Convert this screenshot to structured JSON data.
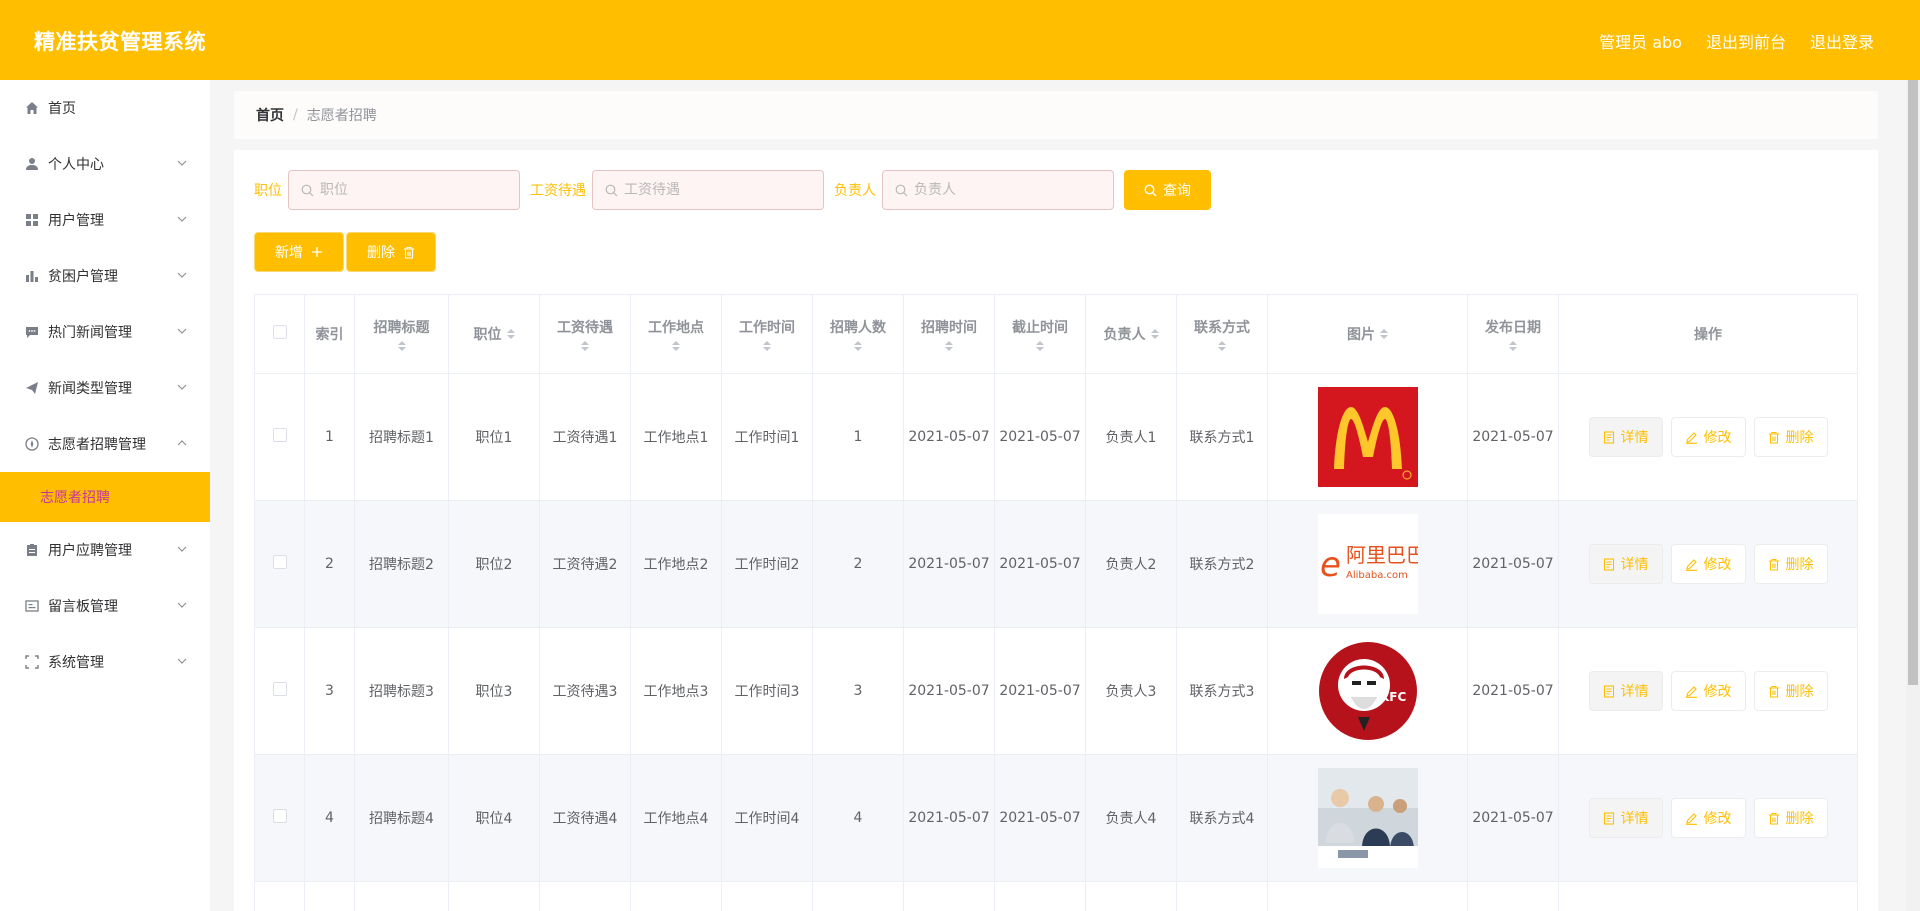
{
  "header": {
    "title": "精准扶贫管理系统",
    "admin": "管理员 abo",
    "front": "退出到前台",
    "logout": "退出登录",
    "color": "#ffbf00"
  },
  "sidebar": {
    "items": [
      {
        "label": "首页",
        "icon": "home-icon"
      },
      {
        "label": "个人中心",
        "icon": "user-icon"
      },
      {
        "label": "用户管理",
        "icon": "grid-icon"
      },
      {
        "label": "贫困户管理",
        "icon": "bar-chart-icon"
      },
      {
        "label": "热门新闻管理",
        "icon": "chat-icon"
      },
      {
        "label": "新闻类型管理",
        "icon": "send-icon"
      },
      {
        "label": "志愿者招聘管理",
        "icon": "compass-icon"
      },
      {
        "label": "用户应聘管理",
        "icon": "clipboard-icon"
      },
      {
        "label": "留言板管理",
        "icon": "message-icon"
      },
      {
        "label": "系统管理",
        "icon": "fullscreen-icon"
      }
    ],
    "active_sub": "志愿者招聘"
  },
  "breadcrumb": {
    "home": "首页",
    "separator": "/",
    "current": "志愿者招聘"
  },
  "search": {
    "position_label": "职位",
    "position_placeholder": "职位",
    "salary_label": "工资待遇",
    "salary_placeholder": "工资待遇",
    "manager_label": "负责人",
    "manager_placeholder": "负责人",
    "query_label": "查询"
  },
  "actions": {
    "add": "新增",
    "delete": "删除"
  },
  "table": {
    "headers": [
      "索引",
      "招聘标题",
      "职位",
      "工资待遇",
      "工作地点",
      "工作时间",
      "招聘人数",
      "招聘时间",
      "截止时间",
      "负责人",
      "联系方式",
      "图片",
      "发布日期",
      "操作"
    ],
    "rows": [
      {
        "index": "1",
        "title": "招聘标题1",
        "position": "职位1",
        "salary": "工资待遇1",
        "location": "工作地点1",
        "worktime": "工作时间1",
        "count": "1",
        "recruit_time": "2021-05-07",
        "deadline": "2021-05-07",
        "manager": "负责人1",
        "contact": "联系方式1",
        "image": "mcdonalds-logo",
        "publish": "2021-05-07"
      },
      {
        "index": "2",
        "title": "招聘标题2",
        "position": "职位2",
        "salary": "工资待遇2",
        "location": "工作地点2",
        "worktime": "工作时间2",
        "count": "2",
        "recruit_time": "2021-05-07",
        "deadline": "2021-05-07",
        "manager": "负责人2",
        "contact": "联系方式2",
        "image": "alibaba-logo",
        "publish": "2021-05-07"
      },
      {
        "index": "3",
        "title": "招聘标题3",
        "position": "职位3",
        "salary": "工资待遇3",
        "location": "工作地点3",
        "worktime": "工作时间3",
        "count": "3",
        "recruit_time": "2021-05-07",
        "deadline": "2021-05-07",
        "manager": "负责人3",
        "contact": "联系方式3",
        "image": "kfc-logo",
        "publish": "2021-05-07"
      },
      {
        "index": "4",
        "title": "招聘标题4",
        "position": "职位4",
        "salary": "工资待遇4",
        "location": "工作地点4",
        "worktime": "工作时间4",
        "count": "4",
        "recruit_time": "2021-05-07",
        "deadline": "2021-05-07",
        "manager": "负责人4",
        "contact": "联系方式4",
        "image": "office-photo",
        "publish": "2021-05-07"
      }
    ],
    "ops": {
      "detail": "详情",
      "edit": "修改",
      "delete": "删除"
    },
    "alibaba_cn": "阿里巴巴",
    "alibaba_en": "Alibaba.com",
    "kfc_text": "KFC"
  }
}
